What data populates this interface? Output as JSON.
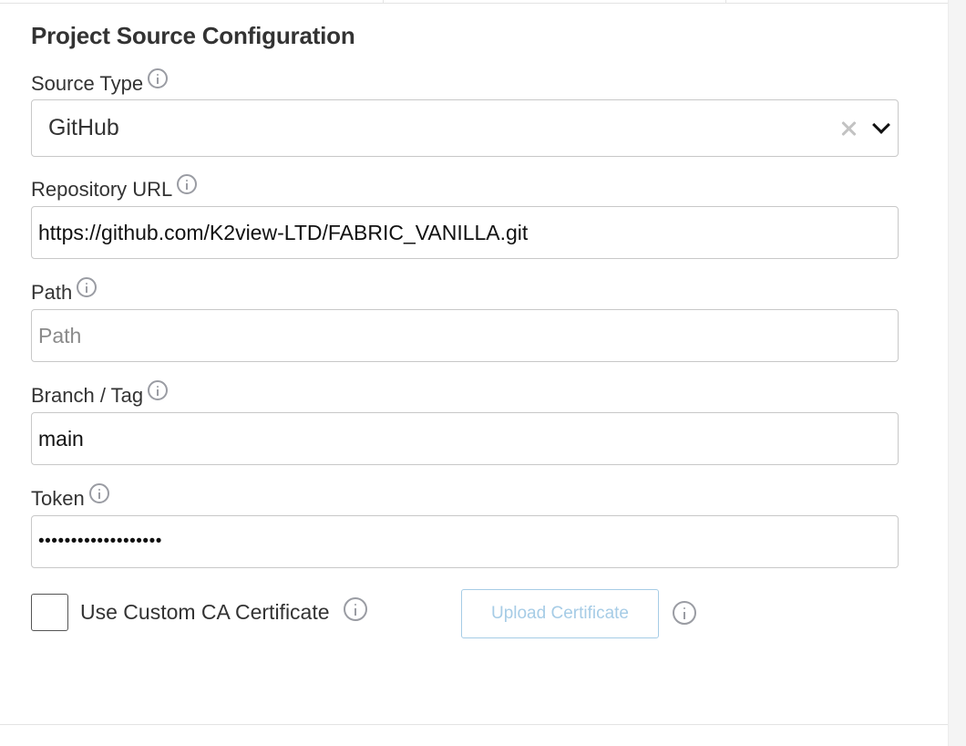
{
  "section": {
    "title": "Project Source Configuration"
  },
  "source_type": {
    "label": "Source Type",
    "value": "GitHub",
    "icons": [
      "info-icon",
      "clear-icon",
      "chevron-down-icon"
    ]
  },
  "repository_url": {
    "label": "Repository URL",
    "value": "https://github.com/K2view-LTD/FABRIC_VANILLA.git",
    "placeholder": ""
  },
  "path": {
    "label": "Path",
    "value": "",
    "placeholder": "Path"
  },
  "branch_tag": {
    "label": "Branch / Tag",
    "value": "main",
    "placeholder": ""
  },
  "token": {
    "label": "Token",
    "value": "•••••••••••••••••••",
    "placeholder": ""
  },
  "custom_ca": {
    "label": "Use Custom CA Certificate",
    "checked": false
  },
  "upload_certificate": {
    "label": "Upload Certificate",
    "disabled": true
  },
  "colors": {
    "border": "#c8c8c8",
    "upload_button": "#a6cce6",
    "info_icon": "#9a9ca3"
  }
}
